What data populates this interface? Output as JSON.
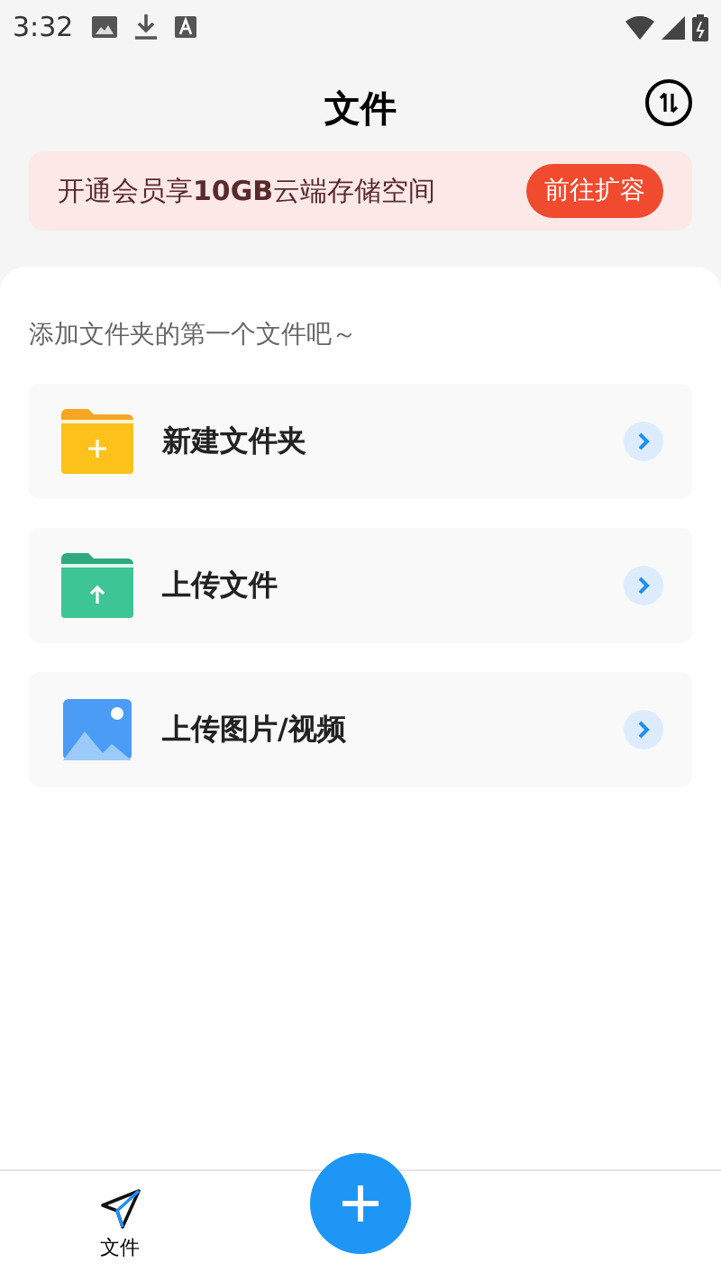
{
  "status_bar": {
    "time": "3:32"
  },
  "header": {
    "title": "文件"
  },
  "banner": {
    "text": "开通会员享**10GB**云端存储空间",
    "button": "前往扩容"
  },
  "hint": "添加文件夹的第一个文件吧～",
  "actions": [
    {
      "kind": "new-folder",
      "label": "新建文件夹"
    },
    {
      "kind": "upload-file",
      "label": "上传文件"
    },
    {
      "kind": "upload-media",
      "label": "上传图片/视频"
    }
  ],
  "tabs": [
    {
      "label": "文件",
      "selected": true
    }
  ]
}
